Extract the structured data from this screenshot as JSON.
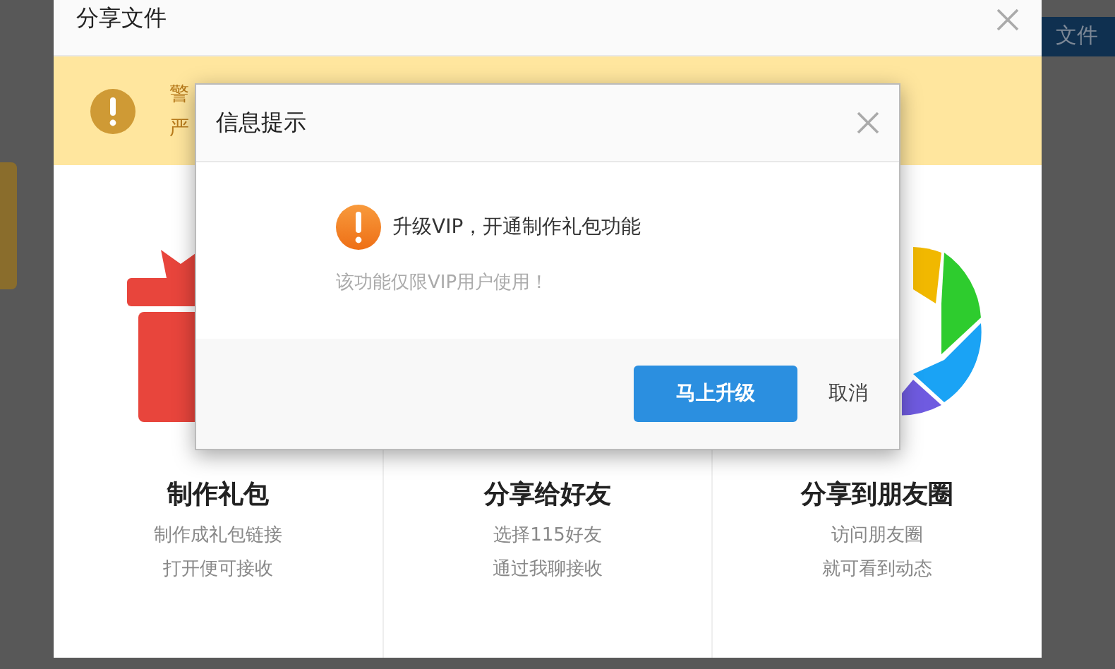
{
  "background": {
    "upload_button": "文件"
  },
  "dialog": {
    "title": "分享文件",
    "warning": {
      "lines": [
        "警",
        "严"
      ]
    },
    "options": [
      {
        "title": "制作礼包",
        "lines": [
          "制作成礼包链接",
          "打开便可接收"
        ]
      },
      {
        "title": "分享给好友",
        "lines": [
          "选择115好友",
          "通过我聊接收"
        ]
      },
      {
        "title": "分享到朋友圈",
        "lines": [
          "访问朋友圈",
          "就可看到动态"
        ]
      }
    ]
  },
  "modal": {
    "title": "信息提示",
    "message": "升级VIP，开通制作礼包功能",
    "note": "该功能仅限VIP用户使用！",
    "buttons": [
      {
        "kind": "primary",
        "label": "马上升级"
      },
      {
        "kind": "link",
        "label": "取消"
      }
    ]
  }
}
